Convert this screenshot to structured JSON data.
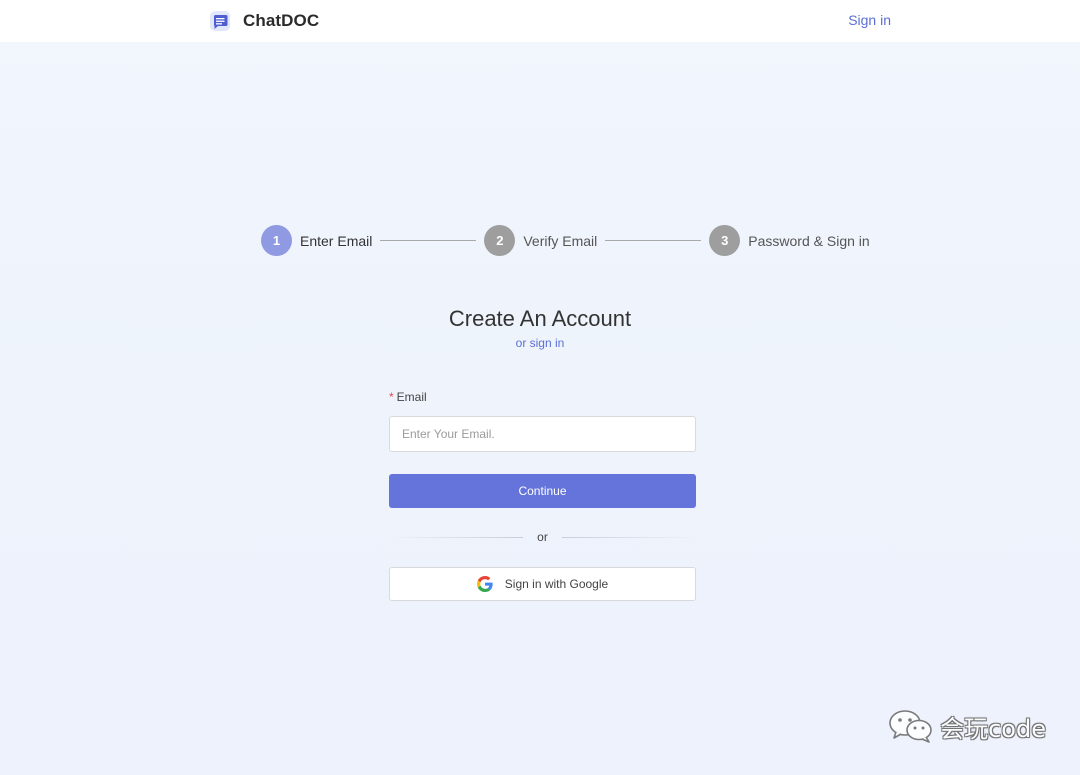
{
  "header": {
    "brand_name": "ChatDOC",
    "signin_label": "Sign in",
    "logo_icon": "chat-document-icon"
  },
  "stepper": {
    "steps": [
      {
        "number": "1",
        "label": "Enter Email",
        "state": "active"
      },
      {
        "number": "2",
        "label": "Verify Email",
        "state": "inactive"
      },
      {
        "number": "3",
        "label": "Password & Sign in",
        "state": "inactive"
      }
    ]
  },
  "main": {
    "title": "Create An Account",
    "or_signin_label": "or sign in"
  },
  "form": {
    "email_label": "Email",
    "required_mark": "*",
    "email_placeholder": "Enter Your Email.",
    "email_value": "",
    "continue_label": "Continue",
    "divider_text": "or",
    "google_label": "Sign in with Google",
    "google_icon": "google-g-icon"
  },
  "watermark": {
    "text": "会玩code",
    "icon": "wechat-icon"
  },
  "colors": {
    "accent": "#6474db",
    "active_step": "#8f9ae3",
    "inactive_step": "#9e9e9e",
    "link": "#5b6fd6",
    "background": "#eef3fc",
    "required": "#e24a4a"
  }
}
